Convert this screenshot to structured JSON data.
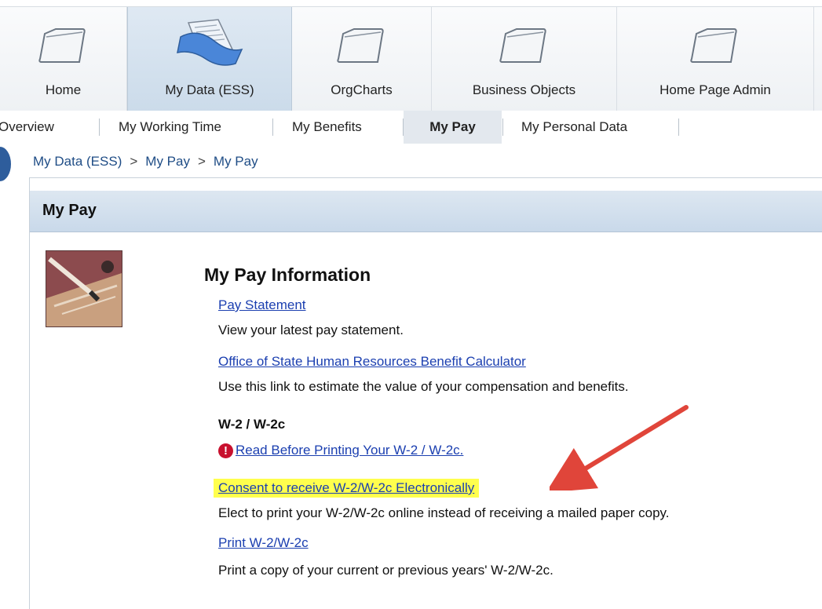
{
  "top_tabs": [
    {
      "label": "Home",
      "icon": "folder-icon",
      "active": false
    },
    {
      "label": "My Data (ESS)",
      "icon": "documents-icon",
      "active": true
    },
    {
      "label": "OrgCharts",
      "icon": "folder-icon",
      "active": false
    },
    {
      "label": "Business Objects",
      "icon": "folder-icon",
      "active": false
    },
    {
      "label": "Home Page Admin",
      "icon": "folder-icon",
      "active": false
    }
  ],
  "sub_nav": [
    {
      "label": "Overview",
      "active": false
    },
    {
      "label": "My Working Time",
      "active": false
    },
    {
      "label": "My Benefits",
      "active": false
    },
    {
      "label": "My Pay",
      "active": true
    },
    {
      "label": "My Personal Data",
      "active": false
    }
  ],
  "breadcrumb": [
    "My Data (ESS)",
    "My Pay",
    "My Pay"
  ],
  "breadcrumb_separator": ">",
  "panel": {
    "title": "My Pay",
    "heading": "My Pay Information",
    "pay_statement": {
      "link": "Pay Statement",
      "desc": "View your latest pay statement."
    },
    "calculator": {
      "link": "Office of State Human Resources Benefit Calculator",
      "desc": "Use this link to estimate the value of your compensation and benefits."
    },
    "w2_heading": "W-2 / W-2c",
    "read_before": {
      "link": " Read Before Printing Your W-2 / W-2c.",
      "icon": "exclamation-icon"
    },
    "consent": {
      "link": "Consent to receive W-2/W-2c Electronically",
      "desc": "Elect to print your W-2/W-2c online instead of receiving a mailed paper copy."
    },
    "print": {
      "link": "Print W-2/W-2c",
      "desc": "Print a copy of your current or previous years' W-2/W-2c."
    }
  },
  "colors": {
    "link": "#1b3fb0",
    "highlight": "#ffff4d",
    "arrow": "#e0453a",
    "warning": "#c8102e"
  }
}
